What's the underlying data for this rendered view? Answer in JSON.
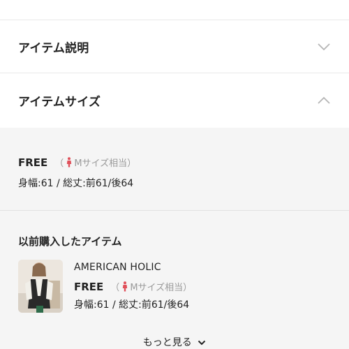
{
  "accordion": {
    "description_label": "アイテム説明",
    "size_label": "アイテムサイズ"
  },
  "size": {
    "name": "FREE",
    "fit_open": "（",
    "fit_label": "Mサイズ相当",
    "fit_close": "）",
    "measurements": "身幅:61 / 総丈:前61/後64"
  },
  "history": {
    "title": "以前購入したアイテム",
    "item": {
      "brand": "AMERICAN HOLIC",
      "size_name": "FREE",
      "fit_open": "（",
      "fit_label": "Mサイズ相当",
      "fit_close": "）",
      "measurements": "身幅:61 / 総丈:前61/後64"
    },
    "more_label": "もっと見る"
  },
  "colors": {
    "accent_figure": "#e0505a",
    "muted_text": "#9a9a9a"
  }
}
